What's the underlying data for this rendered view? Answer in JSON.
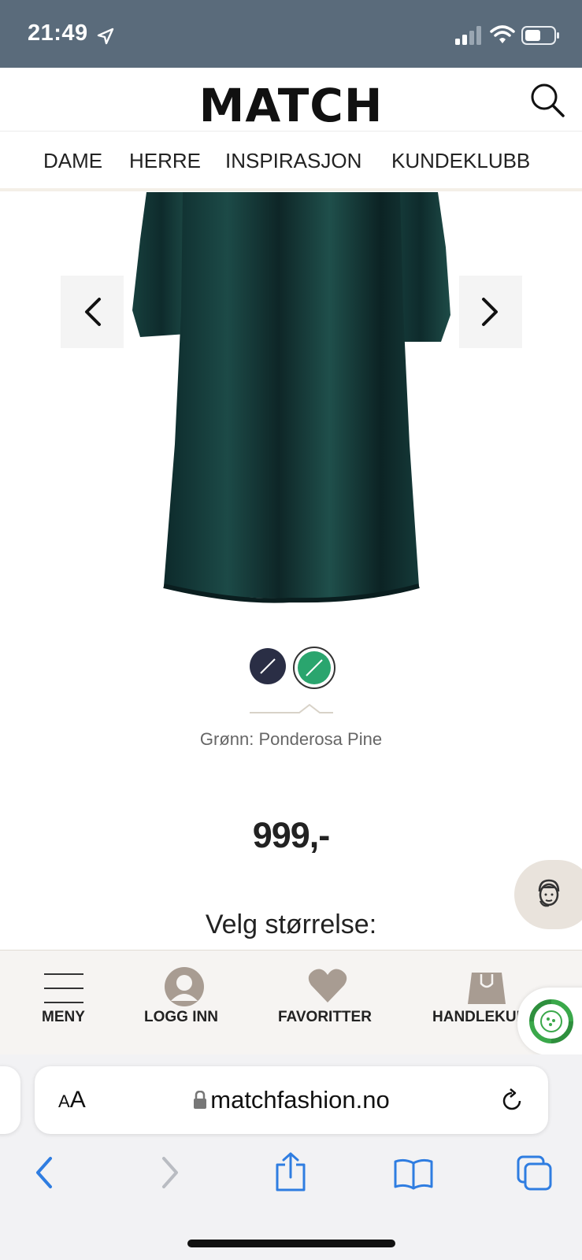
{
  "status_bar": {
    "time": "21:49",
    "icons": [
      "location-arrow-icon",
      "signal-icon",
      "wifi-icon",
      "battery-icon"
    ]
  },
  "header": {
    "logo": "MATCH",
    "search_icon": "search-icon"
  },
  "nav": {
    "items": [
      "DAME",
      "HERRE",
      "INSPIRASJON",
      "KUNDEKLUBB"
    ]
  },
  "product": {
    "image": "dark green velvet dress",
    "prev_icon": "chevron-left-icon",
    "next_icon": "chevron-right-icon",
    "swatches": [
      {
        "color": "#2a2e45",
        "selected": false
      },
      {
        "color": "#2aa56e",
        "selected": true
      }
    ],
    "color_label": "Grønn: Ponderosa Pine",
    "price": "999,-",
    "size_heading": "Velg størrelse:"
  },
  "app_nav": {
    "items": [
      {
        "label": "MENY",
        "icon": "menu-icon"
      },
      {
        "label": "LOGG INN",
        "icon": "user-icon"
      },
      {
        "label": "FAVORITTER",
        "icon": "heart-icon"
      },
      {
        "label": "HANDLEKURV",
        "icon": "shopping-bag-icon"
      }
    ]
  },
  "safari": {
    "aa_label": "AA",
    "url": "matchfashion.no",
    "toolbar_icons": [
      "back-icon",
      "forward-icon",
      "share-icon",
      "bookmarks-icon",
      "tabs-icon"
    ]
  },
  "colors": {
    "accent_blue": "#2f7de1",
    "brand_beige": "#a89c92",
    "status_bar": "#5a6b7b"
  }
}
